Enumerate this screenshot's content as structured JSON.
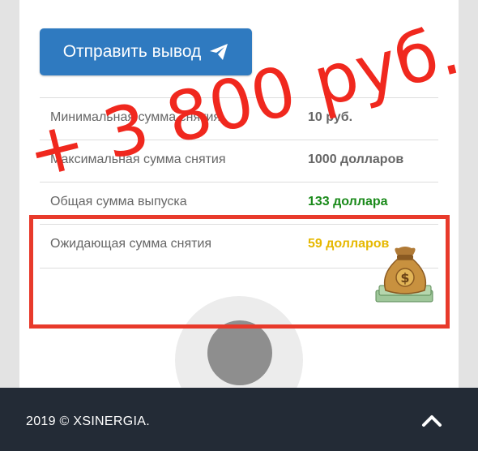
{
  "actions": {
    "submit_withdrawal_label": "Отправить вывод"
  },
  "stats": {
    "rows": [
      {
        "label": "Минимальная сумма снятия",
        "value": "10 руб."
      },
      {
        "label": "Максимальная сумма снятия",
        "value": "1000 долларов"
      },
      {
        "label": "Общая сумма выпуска",
        "value": "133 доллара"
      },
      {
        "label": "Ожидающая сумма снятия",
        "value": "59 долларов"
      }
    ]
  },
  "overlay": {
    "promo_line1": "+ 3 800 руб.",
    "highlight_color": "#e83a2b",
    "promo_color": "#f0281e"
  },
  "icons": {
    "send": "paper-plane-icon",
    "money": "money-bag-icon",
    "scroll_top": "chevron-up-icon"
  },
  "footer": {
    "copyright": "2019 © XSINERGIA."
  },
  "colors": {
    "button": "#2f7ac0",
    "total_value": "#1a8a1a",
    "pending_value": "#e6b800",
    "footer_bg": "#232b36"
  }
}
